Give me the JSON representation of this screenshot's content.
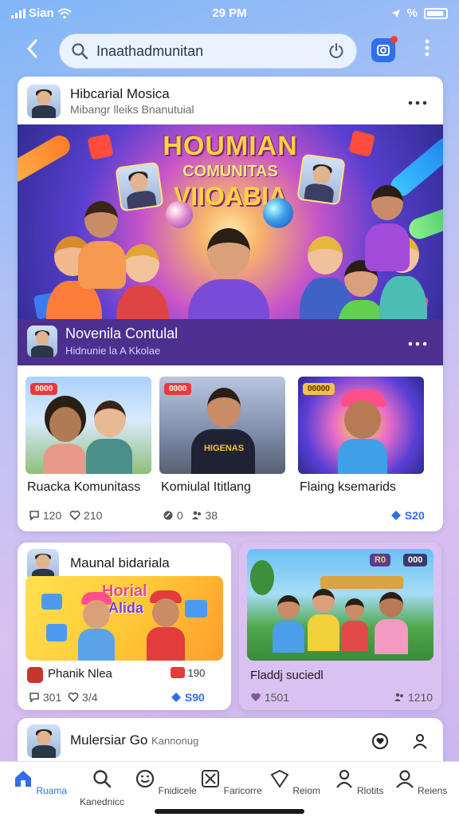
{
  "status": {
    "carrier": "Sian",
    "time": "29 PM",
    "battery_label": "%"
  },
  "search": {
    "value": "Inaathadmunitan",
    "placeholder": ""
  },
  "main_card": {
    "author": "Hibcarial Mosica",
    "subtitle": "Mibangr lleiks Bnanutuial",
    "banner_title": "HOUMIAN",
    "banner_sub1": "COMUNITAS",
    "banner_sub2": "VIIOABIA",
    "footer_title": "Novenila Contulal",
    "footer_sub": "Hidnunie la A Kkolae"
  },
  "thumbs": [
    {
      "tag": "0000",
      "label": "Ruacka Komunitass",
      "stat1": "120",
      "stat2": "210"
    },
    {
      "tag": "0000",
      "label": "Komiulal Ititlang",
      "overlay": "HIGENAS",
      "stat1": "0",
      "stat2": "38"
    },
    {
      "tag": "00000",
      "label": "Flaing ksemarids",
      "stat1": "S20"
    }
  ],
  "card_a": {
    "author": "Maunal bidariala",
    "image_text1": "Horial",
    "image_text2": "Alida",
    "title": "Phanik Nlea",
    "badge": "190",
    "stat1": "301",
    "stat2": "3/4",
    "stat3": "S90"
  },
  "card_b": {
    "chip1": "R0",
    "chip2": "000",
    "title": "Fladdj suciedl",
    "stat1": "1501",
    "stat2": "1210"
  },
  "card_bottom": {
    "author": "Mulersiar Go",
    "sub": "Kannonug"
  },
  "tabs": [
    {
      "label": "Ruama",
      "icon": "home-icon",
      "active": true
    },
    {
      "label": "Kanednicc",
      "icon": "search-icon"
    },
    {
      "label": "Fnidicele",
      "icon": "smile-icon"
    },
    {
      "label": "Faricorre",
      "icon": "tools-icon"
    },
    {
      "label": "Reiom",
      "icon": "inbox-icon"
    },
    {
      "label": "Rlotits",
      "icon": "person-icon"
    },
    {
      "label": "Reiens",
      "icon": "profile-icon"
    }
  ],
  "colors": {
    "accent": "#2f6fe8",
    "banner_footer": "#4c2f8f",
    "tag_red": "#e63b3b"
  }
}
